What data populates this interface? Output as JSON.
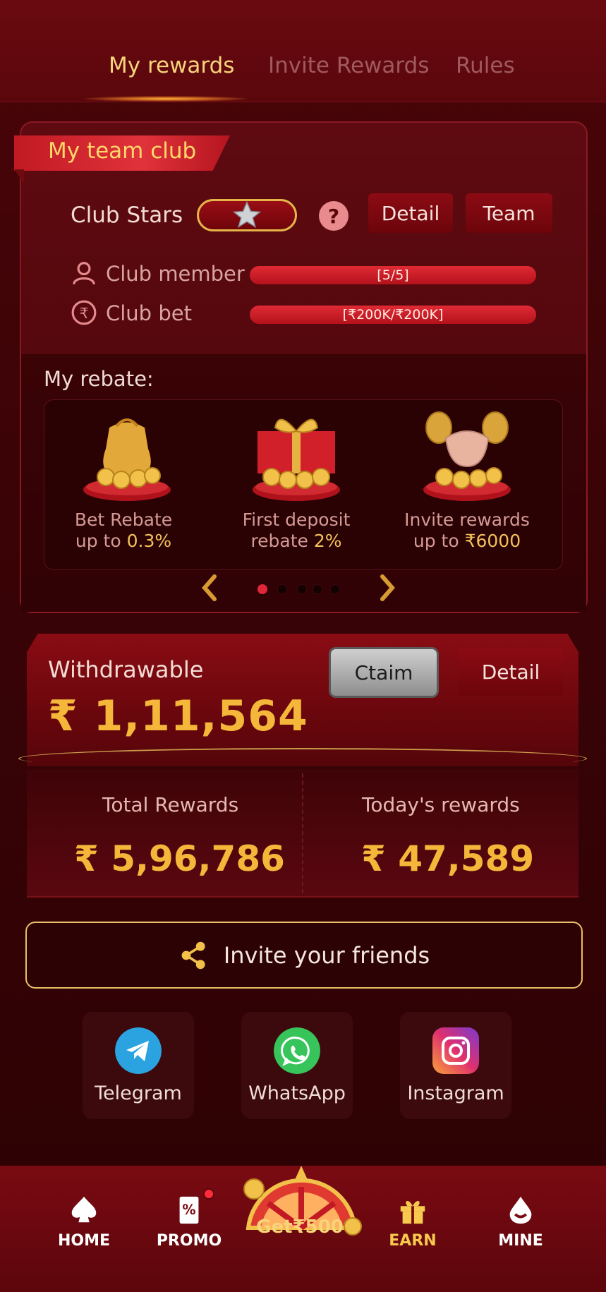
{
  "tabs": [
    {
      "label": "My rewards",
      "active": true
    },
    {
      "label": "Invite Rewards",
      "active": false
    },
    {
      "label": "Rules",
      "active": false
    }
  ],
  "club": {
    "title": "My team club",
    "stars_label": "Club Stars",
    "help_symbol": "?",
    "detail_label": "Detail",
    "team_label": "Team",
    "member_label": "Club member",
    "member_value": "[5/5]",
    "member_progress": 1.0,
    "bet_label": "Club bet",
    "bet_value": "[₹200K/₹200K]",
    "bet_progress": 1.0
  },
  "rebate": {
    "label": "My rebate:",
    "items": [
      {
        "line1": "Bet Rebate",
        "line2_prefix": "up to ",
        "line2_value": "0.3%"
      },
      {
        "line1": "First deposit",
        "line2_prefix": "rebate ",
        "line2_value": "2%"
      },
      {
        "line1": "Invite rewards",
        "line2_prefix": "up to ",
        "line2_value": "₹6000"
      }
    ],
    "page_current": 1,
    "page_total": 5
  },
  "withdraw": {
    "label": "Withdrawable",
    "amount": "₹ 1,11,564",
    "claim_label": "Ctaim",
    "detail_label": "Detail"
  },
  "totals": {
    "total_label": "Total Rewards",
    "total_amount": "₹ 5,96,786",
    "today_label": "Today's rewards",
    "today_amount": "₹ 47,589"
  },
  "invite": {
    "label": "Invite your friends"
  },
  "social": [
    {
      "label": "Telegram",
      "icon": "telegram-icon",
      "color": "#2aa3e0"
    },
    {
      "label": "WhatsApp",
      "icon": "whatsapp-icon",
      "color": "#37c45a"
    },
    {
      "label": "Instagram",
      "icon": "instagram-icon",
      "color": "#d6306e"
    }
  ],
  "nav": {
    "home": "HOME",
    "promo": "PROMO",
    "get": "Get₹500",
    "earn": "EARN",
    "mine": "MINE",
    "active": "earn"
  },
  "colors": {
    "accent_gold": "#f5b73a",
    "bg_dark_red": "#3a0306",
    "primary_red": "#8c0b14"
  }
}
